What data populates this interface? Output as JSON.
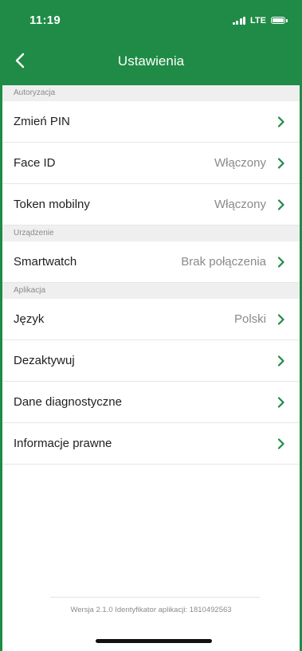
{
  "status_bar": {
    "time": "11:19",
    "network": "LTE"
  },
  "nav": {
    "title": "Ustawienia",
    "back_icon": "chevron-left-icon"
  },
  "sections": [
    {
      "header": "Autoryzacja",
      "rows": [
        {
          "label": "Zmień PIN",
          "value": ""
        },
        {
          "label": "Face ID",
          "value": "Włączony"
        },
        {
          "label": "Token mobilny",
          "value": "Włączony"
        }
      ]
    },
    {
      "header": "Urządzenie",
      "rows": [
        {
          "label": "Smartwatch",
          "value": "Brak połączenia"
        }
      ]
    },
    {
      "header": "Aplikacja",
      "rows": [
        {
          "label": "Język",
          "value": "Polski"
        },
        {
          "label": "Dezaktywuj",
          "value": ""
        },
        {
          "label": "Dane diagnostyczne",
          "value": ""
        },
        {
          "label": "Informacje prawne",
          "value": ""
        }
      ]
    }
  ],
  "footer": {
    "version": "Wersja 2.1.0   Identyfikator aplikacji: 1810492563"
  },
  "colors": {
    "brand_green": "#1f8b46",
    "chevron_green": "#1f8b46",
    "section_bg": "#efefef"
  }
}
